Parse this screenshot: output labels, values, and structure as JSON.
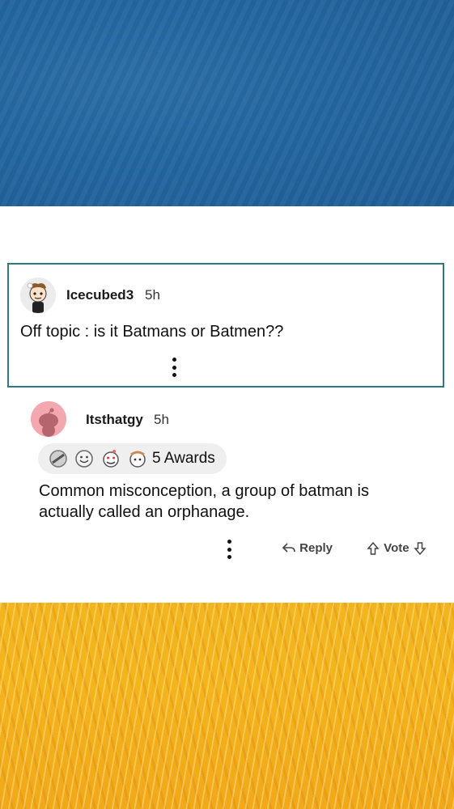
{
  "thread": {
    "parent": {
      "username": "Icecubed3",
      "time": "5h",
      "text": "Off topic : is it Batmans or Batmen??",
      "avatar_icon": "snoo-avatar-icon"
    },
    "reply": {
      "username": "Itsthatgy",
      "time": "5h",
      "awards_label": "5 Awards",
      "award_icons": [
        "silver-award-icon",
        "wholesome-award-icon",
        "laughing-award-icon",
        "helpful-award-icon"
      ],
      "text_line1": "Common misconception, a group of batman is",
      "text_line2": "actually called an orphanage.",
      "actions": {
        "reply_label": "Reply",
        "vote_label": "Vote"
      }
    }
  },
  "colors": {
    "card_border": "#2d7a82",
    "top_background": "#2466a0",
    "bottom_background": "#f4b41c"
  }
}
